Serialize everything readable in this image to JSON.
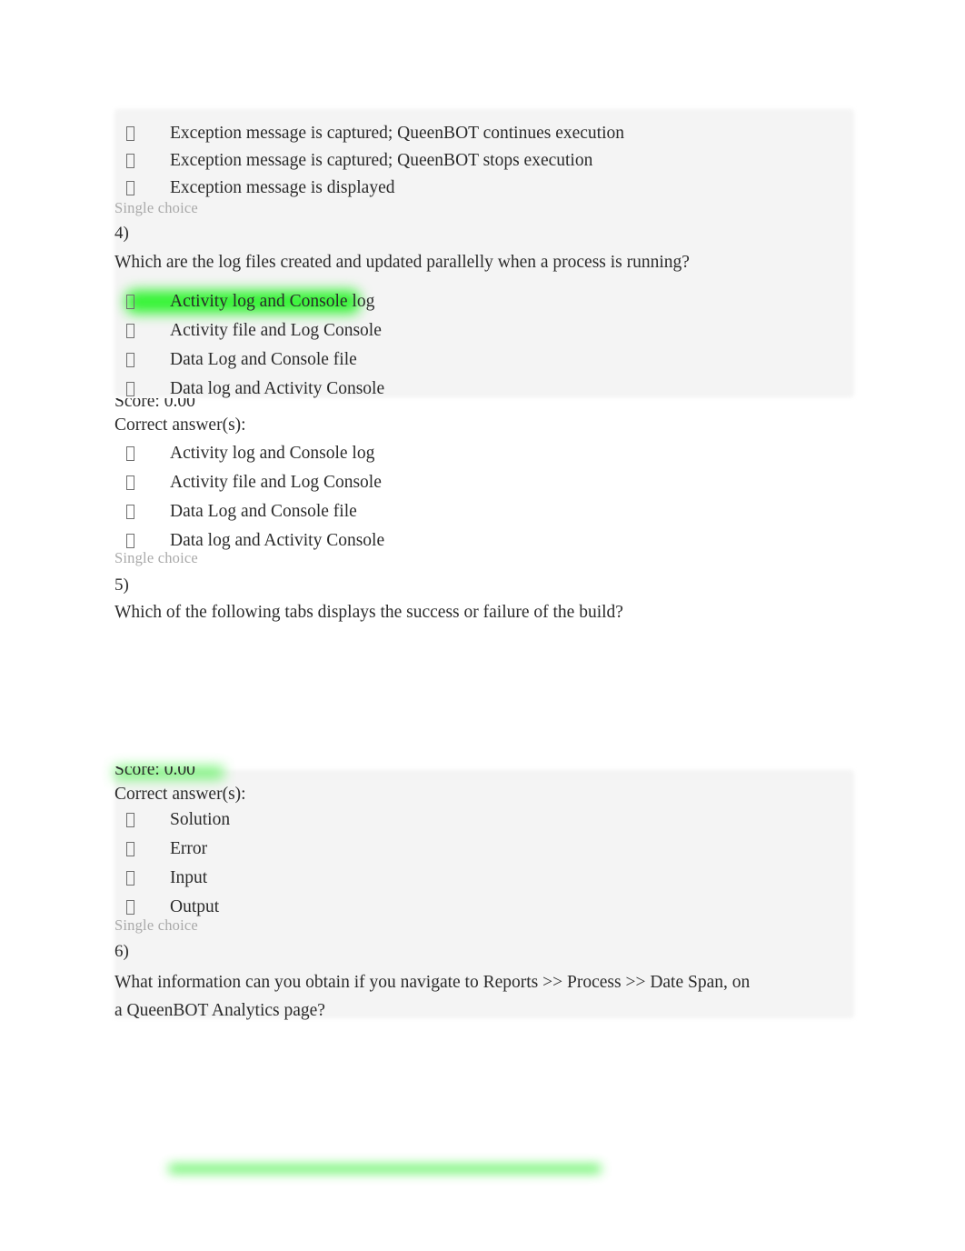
{
  "document": {
    "type": "quiz-results",
    "bullet_glyph": "tofu-box",
    "highlight_color": "#35f335",
    "block_shade_color": "#f4f4f4",
    "meta_label": "Single choice",
    "score_label": "Score: 0.00",
    "correct_answers_label": "Correct answer(s):"
  },
  "question_3_tail": {
    "options": [
      "Exception message is captured; QueenBOT continues execution",
      "Exception message is captured; QueenBOT stops execution",
      "Exception message is displayed"
    ],
    "meta": "Single choice"
  },
  "question_4": {
    "number": "4)",
    "prompt": "Which are the log files created and updated parallelly when a process is running?",
    "options": [
      "Activity log and Console log",
      "Activity file and Log Console",
      "Data Log and Console file",
      "Data log and Activity Console"
    ],
    "highlighted_option_index": 0,
    "score": "Score: 0.00",
    "correct_answers_label": "Correct answer(s):",
    "correct_answers": [
      "Activity log and Console log",
      "Activity file and Log Console",
      "Data Log and Console file",
      "Data log and Activity Console"
    ],
    "meta": "Single choice"
  },
  "question_5": {
    "number": "5)",
    "prompt": "Which of the following tabs displays the success or failure of the build?",
    "score": "Score: 0.00",
    "correct_answers_label": "Correct answer(s):",
    "correct_answers": [
      "Solution",
      "Error",
      "Input",
      "Output"
    ],
    "meta": "Single choice"
  },
  "question_6": {
    "number": "6)",
    "prompt": "What information can you obtain if you navigate to Reports >> Process >> Date Span, on a QueenBOT Analytics page?"
  }
}
